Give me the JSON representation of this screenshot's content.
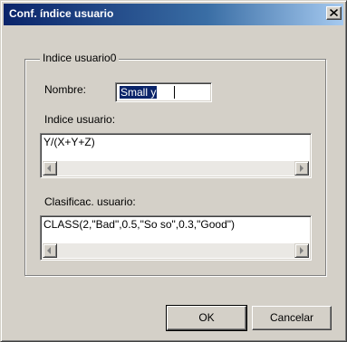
{
  "window": {
    "title": "Conf. índice usuario"
  },
  "group": {
    "legend": "Indice usuario0"
  },
  "nombre": {
    "label": "Nombre:",
    "value": "Small y"
  },
  "indice": {
    "label": "Indice usuario:",
    "value": "Y/(X+Y+Z)"
  },
  "clasificac": {
    "label": "Clasificac. usuario:",
    "value": "CLASS(2,\"Bad\",0.5,\"So so\",0.3,\"Good\")"
  },
  "buttons": {
    "ok_label": "OK",
    "cancel_label": "Cancelar"
  },
  "icons": {
    "close": "close-icon",
    "scroll_left": "arrow-left-icon",
    "scroll_right": "arrow-right-icon"
  },
  "colors": {
    "title_start": "#0a246a",
    "title_end": "#a6caf0",
    "face": "#d4d0c8",
    "selection": "#0a246a"
  }
}
